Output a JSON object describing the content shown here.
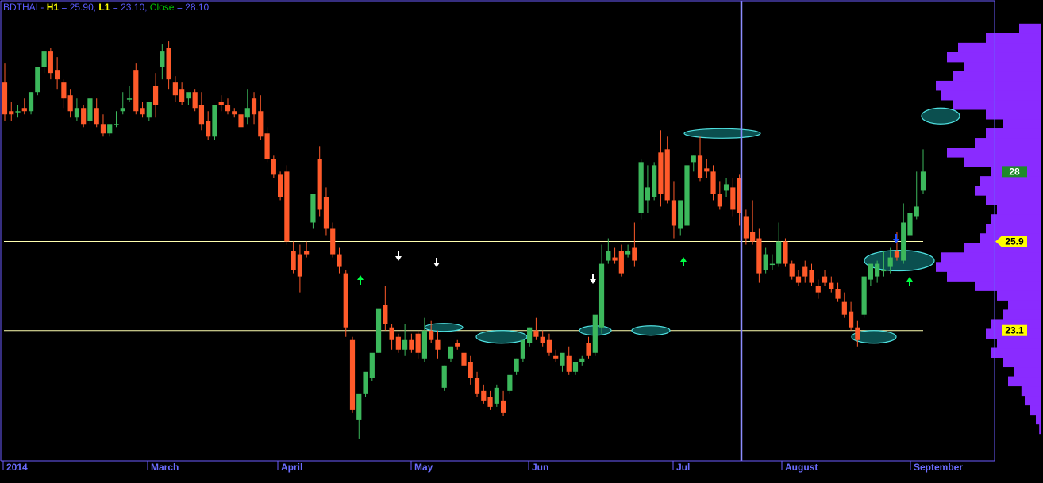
{
  "header": {
    "symbol": "BDTHAI",
    "sep1": " - ",
    "h1_label": "H1",
    "h1_value": " = 25.90, ",
    "l1_label": "L1",
    "l1_value": " = 23.10, ",
    "close_label": "Close",
    "close_value": " = 28.10"
  },
  "colors": {
    "background": "#000000",
    "frame": "#6c5cff",
    "up": "#3cb85c",
    "down": "#ff5a2a",
    "level_line": "#ffffb0",
    "volume_profile": "#8a2bff",
    "ellipse_fill": "#0b4f4f",
    "ellipse_stroke": "#4fe0e0",
    "marker_up": "#00ff44",
    "marker_down": "#ffffff",
    "marker_blue": "#2050ff",
    "badge_close": "#1f8a2a",
    "badge_level": "#ffff00"
  },
  "chart_data": {
    "type": "candlestick",
    "symbol": "BDTHAI",
    "y_range": [
      19.0,
      33.5
    ],
    "x_labels": [
      "2014",
      "March",
      "April",
      "May",
      "Jun",
      "Jul",
      "August",
      "September"
    ],
    "levels": [
      {
        "name": "H1",
        "value": 25.9,
        "label": "25.9"
      },
      {
        "name": "L1",
        "value": 23.1,
        "label": "23.1"
      }
    ],
    "close": {
      "value": 28.1,
      "label": "28"
    },
    "series": [
      {
        "o": 30.9,
        "h": 31.5,
        "c": 29.9,
        "l": 29.7
      },
      {
        "o": 30.0,
        "h": 30.3,
        "c": 29.9,
        "l": 29.7
      },
      {
        "o": 30.0,
        "h": 30.2,
        "c": 30.0,
        "l": 29.8
      },
      {
        "o": 30.1,
        "h": 30.4,
        "c": 30.0,
        "l": 29.9
      },
      {
        "o": 30.0,
        "h": 30.6,
        "c": 30.6,
        "l": 29.9
      },
      {
        "o": 30.6,
        "h": 31.3,
        "c": 31.4,
        "l": 30.5
      },
      {
        "o": 31.4,
        "h": 31.8,
        "c": 31.9,
        "l": 31.2
      },
      {
        "o": 31.9,
        "h": 32.0,
        "c": 31.2,
        "l": 31.0
      },
      {
        "o": 31.3,
        "h": 31.7,
        "c": 31.0,
        "l": 30.7
      },
      {
        "o": 30.9,
        "h": 31.0,
        "c": 30.4,
        "l": 30.1
      },
      {
        "o": 30.5,
        "h": 30.7,
        "c": 30.0,
        "l": 29.8
      },
      {
        "o": 29.8,
        "h": 30.4,
        "c": 30.1,
        "l": 29.7
      },
      {
        "o": 30.1,
        "h": 30.2,
        "c": 29.6,
        "l": 29.5
      },
      {
        "o": 29.7,
        "h": 30.3,
        "c": 30.4,
        "l": 29.6
      },
      {
        "o": 30.1,
        "h": 30.4,
        "c": 29.6,
        "l": 29.5
      },
      {
        "o": 29.6,
        "h": 29.9,
        "c": 29.3,
        "l": 29.2
      },
      {
        "o": 29.3,
        "h": 29.4,
        "c": 29.6,
        "l": 29.2
      },
      {
        "o": 29.6,
        "h": 30.0,
        "c": 29.6,
        "l": 29.5
      },
      {
        "o": 30.0,
        "h": 30.6,
        "c": 30.1,
        "l": 29.9
      },
      {
        "o": 30.4,
        "h": 30.8,
        "c": 30.4,
        "l": 30.3
      },
      {
        "o": 31.3,
        "h": 31.5,
        "c": 30.0,
        "l": 29.9
      },
      {
        "o": 30.1,
        "h": 30.3,
        "c": 29.9,
        "l": 29.8
      },
      {
        "o": 29.8,
        "h": 30.3,
        "c": 30.3,
        "l": 29.7
      },
      {
        "o": 30.8,
        "h": 31.2,
        "c": 30.2,
        "l": 29.8
      },
      {
        "o": 31.4,
        "h": 32.1,
        "c": 31.9,
        "l": 31.0
      },
      {
        "o": 32.0,
        "h": 32.2,
        "c": 31.0,
        "l": 30.7
      },
      {
        "o": 30.9,
        "h": 31.1,
        "c": 30.5,
        "l": 30.3
      },
      {
        "o": 30.7,
        "h": 30.9,
        "c": 30.3,
        "l": 30.2
      },
      {
        "o": 30.4,
        "h": 30.5,
        "c": 30.6,
        "l": 30.2
      },
      {
        "o": 30.6,
        "h": 30.7,
        "c": 30.1,
        "l": 30.0
      },
      {
        "o": 30.2,
        "h": 30.6,
        "c": 29.6,
        "l": 29.4
      },
      {
        "o": 29.7,
        "h": 30.0,
        "c": 29.2,
        "l": 29.1
      },
      {
        "o": 29.2,
        "h": 29.9,
        "c": 30.2,
        "l": 29.1
      },
      {
        "o": 30.3,
        "h": 30.5,
        "c": 30.2,
        "l": 30.0
      },
      {
        "o": 30.2,
        "h": 30.4,
        "c": 30.0,
        "l": 29.9
      },
      {
        "o": 30.0,
        "h": 30.1,
        "c": 29.9,
        "l": 29.8
      },
      {
        "o": 29.9,
        "h": 30.4,
        "c": 29.5,
        "l": 29.4
      },
      {
        "o": 29.8,
        "h": 30.7,
        "c": 30.1,
        "l": 29.6
      },
      {
        "o": 30.4,
        "h": 30.6,
        "c": 29.9,
        "l": 29.6
      },
      {
        "o": 30.0,
        "h": 30.5,
        "c": 29.2,
        "l": 29.1
      },
      {
        "o": 29.3,
        "h": 29.5,
        "c": 28.5,
        "l": 28.4
      },
      {
        "o": 28.5,
        "h": 28.6,
        "c": 28.0,
        "l": 27.9
      },
      {
        "o": 28.0,
        "h": 28.1,
        "c": 27.3,
        "l": 27.2
      },
      {
        "o": 28.1,
        "h": 28.3,
        "c": 25.9,
        "l": 25.8
      },
      {
        "o": 25.6,
        "h": 25.9,
        "c": 25.0,
        "l": 24.9
      },
      {
        "o": 25.5,
        "h": 25.8,
        "c": 24.8,
        "l": 24.3
      },
      {
        "o": 25.6,
        "h": 25.9,
        "c": 25.5,
        "l": 25.4
      },
      {
        "o": 26.5,
        "h": 27.0,
        "c": 27.4,
        "l": 26.3
      },
      {
        "o": 28.5,
        "h": 28.9,
        "c": 26.9,
        "l": 26.7
      },
      {
        "o": 27.3,
        "h": 27.6,
        "c": 26.3,
        "l": 26.1
      },
      {
        "o": 26.3,
        "h": 26.5,
        "c": 25.5,
        "l": 25.4
      },
      {
        "o": 25.5,
        "h": 25.7,
        "c": 25.1,
        "l": 24.9
      },
      {
        "o": 24.9,
        "h": 25.0,
        "c": 23.2,
        "l": 22.9
      },
      {
        "o": 22.8,
        "h": 22.9,
        "c": 20.6,
        "l": 20.5
      },
      {
        "o": 20.3,
        "h": 21.0,
        "c": 21.1,
        "l": 19.7
      },
      {
        "o": 21.1,
        "h": 21.5,
        "c": 21.8,
        "l": 21.0
      },
      {
        "o": 21.6,
        "h": 22.0,
        "c": 22.4,
        "l": 21.5
      },
      {
        "o": 22.4,
        "h": 23.6,
        "c": 23.8,
        "l": 22.4
      },
      {
        "o": 23.9,
        "h": 24.5,
        "c": 23.3,
        "l": 23.1
      },
      {
        "o": 23.2,
        "h": 23.3,
        "c": 22.8,
        "l": 22.5
      },
      {
        "o": 22.9,
        "h": 23.0,
        "c": 22.5,
        "l": 22.4
      },
      {
        "o": 22.5,
        "h": 23.3,
        "c": 22.8,
        "l": 22.3
      },
      {
        "o": 22.8,
        "h": 23.0,
        "c": 22.5,
        "l": 22.4
      },
      {
        "o": 23.0,
        "h": 23.1,
        "c": 22.4,
        "l": 22.2
      },
      {
        "o": 22.2,
        "h": 23.5,
        "c": 23.1,
        "l": 22.1
      },
      {
        "o": 23.1,
        "h": 23.4,
        "c": 22.8,
        "l": 22.7
      },
      {
        "o": 22.8,
        "h": 23.1,
        "c": 22.5,
        "l": 22.2
      },
      {
        "o": 21.3,
        "h": 22.0,
        "c": 22.0,
        "l": 21.2
      },
      {
        "o": 22.2,
        "h": 22.6,
        "c": 22.6,
        "l": 22.1
      },
      {
        "o": 22.7,
        "h": 22.8,
        "c": 22.6,
        "l": 22.5
      },
      {
        "o": 22.4,
        "h": 22.6,
        "c": 22.0,
        "l": 21.9
      },
      {
        "o": 22.1,
        "h": 22.3,
        "c": 21.6,
        "l": 21.4
      },
      {
        "o": 21.6,
        "h": 21.8,
        "c": 21.1,
        "l": 21.0
      },
      {
        "o": 21.2,
        "h": 21.4,
        "c": 20.9,
        "l": 20.8
      },
      {
        "o": 21.0,
        "h": 21.2,
        "c": 20.7,
        "l": 20.6
      },
      {
        "o": 20.8,
        "h": 21.4,
        "c": 21.3,
        "l": 20.7
      },
      {
        "o": 20.9,
        "h": 21.2,
        "c": 20.5,
        "l": 20.4
      },
      {
        "o": 21.2,
        "h": 21.6,
        "c": 21.7,
        "l": 21.1
      },
      {
        "o": 21.8,
        "h": 22.2,
        "c": 22.2,
        "l": 21.7
      },
      {
        "o": 22.2,
        "h": 22.7,
        "c": 22.8,
        "l": 22.1
      },
      {
        "o": 22.7,
        "h": 23.2,
        "c": 23.2,
        "l": 22.6
      },
      {
        "o": 23.1,
        "h": 23.5,
        "c": 22.9,
        "l": 22.8
      },
      {
        "o": 22.9,
        "h": 23.1,
        "c": 22.7,
        "l": 22.6
      },
      {
        "o": 22.8,
        "h": 23.0,
        "c": 22.4,
        "l": 22.3
      },
      {
        "o": 22.3,
        "h": 22.5,
        "c": 22.2,
        "l": 22.1
      },
      {
        "o": 22.0,
        "h": 22.3,
        "c": 22.4,
        "l": 21.8
      },
      {
        "o": 22.3,
        "h": 22.6,
        "c": 21.8,
        "l": 21.7
      },
      {
        "o": 21.8,
        "h": 22.0,
        "c": 22.1,
        "l": 21.7
      },
      {
        "o": 22.1,
        "h": 22.3,
        "c": 22.2,
        "l": 22.0
      },
      {
        "o": 22.7,
        "h": 22.9,
        "c": 22.3,
        "l": 22.2
      },
      {
        "o": 22.4,
        "h": 23.3,
        "c": 23.6,
        "l": 22.3
      },
      {
        "o": 23.2,
        "h": 25.8,
        "c": 25.2,
        "l": 23.0
      },
      {
        "o": 25.3,
        "h": 26.0,
        "c": 25.6,
        "l": 25.2
      },
      {
        "o": 25.4,
        "h": 25.7,
        "c": 25.3,
        "l": 25.2
      },
      {
        "o": 25.6,
        "h": 25.8,
        "c": 24.9,
        "l": 24.8
      },
      {
        "o": 25.5,
        "h": 25.8,
        "c": 25.6,
        "l": 25.4
      },
      {
        "o": 25.7,
        "h": 26.5,
        "c": 25.3,
        "l": 25.1
      },
      {
        "o": 26.8,
        "h": 28.5,
        "c": 28.4,
        "l": 26.6
      },
      {
        "o": 27.2,
        "h": 28.3,
        "c": 27.6,
        "l": 26.8
      },
      {
        "o": 27.3,
        "h": 28.4,
        "c": 28.3,
        "l": 27.2
      },
      {
        "o": 28.7,
        "h": 29.4,
        "c": 27.4,
        "l": 27.0
      },
      {
        "o": 28.8,
        "h": 29.2,
        "c": 27.2,
        "l": 27.1
      },
      {
        "o": 27.2,
        "h": 27.8,
        "c": 26.4,
        "l": 26.0
      },
      {
        "o": 26.3,
        "h": 26.6,
        "c": 27.2,
        "l": 26.1
      },
      {
        "o": 26.4,
        "h": 26.7,
        "c": 28.3,
        "l": 26.3
      },
      {
        "o": 28.4,
        "h": 28.6,
        "c": 28.6,
        "l": 28.1
      },
      {
        "o": 28.6,
        "h": 29.2,
        "c": 27.9,
        "l": 27.8
      },
      {
        "o": 28.2,
        "h": 28.5,
        "c": 28.1,
        "l": 27.9
      },
      {
        "o": 28.1,
        "h": 28.3,
        "c": 27.4,
        "l": 27.2
      },
      {
        "o": 27.4,
        "h": 27.8,
        "c": 27.0,
        "l": 26.9
      },
      {
        "o": 27.5,
        "h": 27.9,
        "c": 27.7,
        "l": 27.3
      },
      {
        "o": 27.6,
        "h": 27.9,
        "c": 26.9,
        "l": 26.7
      },
      {
        "o": 27.9,
        "h": 28.0,
        "c": 26.8,
        "l": 26.4
      },
      {
        "o": 26.7,
        "h": 26.9,
        "c": 26.0,
        "l": 25.8
      },
      {
        "o": 26.2,
        "h": 27.2,
        "c": 25.9,
        "l": 25.8
      },
      {
        "o": 26.0,
        "h": 26.3,
        "c": 24.9,
        "l": 24.6
      },
      {
        "o": 25.0,
        "h": 25.7,
        "c": 25.5,
        "l": 24.9
      },
      {
        "o": 25.2,
        "h": 25.5,
        "c": 25.2,
        "l": 25.0
      },
      {
        "o": 25.2,
        "h": 26.5,
        "c": 25.9,
        "l": 25.1
      },
      {
        "o": 25.9,
        "h": 26.0,
        "c": 25.2,
        "l": 25.1
      },
      {
        "o": 25.2,
        "h": 25.3,
        "c": 24.8,
        "l": 24.7
      },
      {
        "o": 24.8,
        "h": 25.0,
        "c": 24.6,
        "l": 24.5
      },
      {
        "o": 25.1,
        "h": 25.3,
        "c": 24.8,
        "l": 24.6
      },
      {
        "o": 25.0,
        "h": 25.2,
        "c": 24.6,
        "l": 24.5
      },
      {
        "o": 24.5,
        "h": 24.7,
        "c": 24.3,
        "l": 24.1
      },
      {
        "o": 24.8,
        "h": 25.0,
        "c": 24.6,
        "l": 24.5
      },
      {
        "o": 24.6,
        "h": 24.8,
        "c": 24.4,
        "l": 24.3
      },
      {
        "o": 24.4,
        "h": 24.6,
        "c": 24.1,
        "l": 24.0
      },
      {
        "o": 24.0,
        "h": 24.3,
        "c": 23.6,
        "l": 23.5
      },
      {
        "o": 23.7,
        "h": 24.0,
        "c": 23.2,
        "l": 23.1
      },
      {
        "o": 23.2,
        "h": 23.4,
        "c": 22.8,
        "l": 22.6
      },
      {
        "o": 23.6,
        "h": 24.0,
        "c": 24.8,
        "l": 23.5
      },
      {
        "o": 24.7,
        "h": 25.1,
        "c": 25.2,
        "l": 24.5
      },
      {
        "o": 24.8,
        "h": 25.3,
        "c": 25.2,
        "l": 24.6
      },
      {
        "o": 25.0,
        "h": 25.6,
        "c": 25.0,
        "l": 24.8
      },
      {
        "o": 25.1,
        "h": 25.7,
        "c": 25.4,
        "l": 24.9
      },
      {
        "o": 25.6,
        "h": 26.2,
        "c": 25.4,
        "l": 25.3
      },
      {
        "o": 25.3,
        "h": 27.1,
        "c": 26.5,
        "l": 25.2
      },
      {
        "o": 26.1,
        "h": 27.0,
        "c": 26.8,
        "l": 26.0
      },
      {
        "o": 26.7,
        "h": 28.1,
        "c": 27.0,
        "l": 26.6
      },
      {
        "o": 27.5,
        "h": 28.8,
        "c": 28.1,
        "l": 27.4
      }
    ],
    "volume_profile": [
      [
        20.0,
        0.02
      ],
      [
        20.3,
        0.05
      ],
      [
        20.6,
        0.1
      ],
      [
        20.9,
        0.15
      ],
      [
        21.2,
        0.18
      ],
      [
        21.5,
        0.3
      ],
      [
        21.8,
        0.25
      ],
      [
        22.1,
        0.35
      ],
      [
        22.4,
        0.45
      ],
      [
        22.7,
        0.4
      ],
      [
        23.0,
        0.5
      ],
      [
        23.3,
        0.45
      ],
      [
        23.6,
        0.35
      ],
      [
        23.9,
        0.3
      ],
      [
        24.2,
        0.4
      ],
      [
        24.5,
        0.6
      ],
      [
        24.8,
        0.85
      ],
      [
        25.1,
        0.95
      ],
      [
        25.4,
        0.9
      ],
      [
        25.7,
        0.7
      ],
      [
        26.0,
        0.55
      ],
      [
        26.3,
        0.5
      ],
      [
        26.6,
        0.45
      ],
      [
        26.9,
        0.4
      ],
      [
        27.2,
        0.5
      ],
      [
        27.5,
        0.6
      ],
      [
        27.8,
        0.55
      ],
      [
        28.1,
        0.45
      ],
      [
        28.4,
        0.7
      ],
      [
        28.7,
        0.85
      ],
      [
        29.0,
        0.6
      ],
      [
        29.3,
        0.5
      ],
      [
        29.6,
        0.35
      ],
      [
        29.9,
        0.5
      ],
      [
        30.2,
        0.8
      ],
      [
        30.5,
        0.9
      ],
      [
        30.8,
        0.95
      ],
      [
        31.1,
        0.8
      ],
      [
        31.4,
        0.7
      ],
      [
        31.7,
        0.85
      ],
      [
        32.0,
        0.75
      ],
      [
        32.3,
        0.5
      ],
      [
        32.6,
        0.2
      ]
    ],
    "ellipses": [
      [
        1185,
        29.85,
        24,
        10
      ],
      [
        910,
        29.3,
        48,
        6
      ],
      [
        559,
        23.2,
        24,
        5
      ],
      [
        632,
        22.9,
        32,
        8
      ],
      [
        750,
        23.1,
        20,
        6
      ],
      [
        820,
        23.1,
        24,
        6
      ],
      [
        1133,
        25.3,
        44,
        13
      ],
      [
        1101,
        22.9,
        28,
        8
      ]
    ],
    "markers": [
      [
        502,
        "down"
      ],
      [
        550,
        "down"
      ],
      [
        747,
        "down"
      ],
      [
        454,
        "up"
      ],
      [
        861,
        "up"
      ],
      [
        1146,
        "up"
      ],
      [
        1129,
        "downblue"
      ]
    ]
  }
}
